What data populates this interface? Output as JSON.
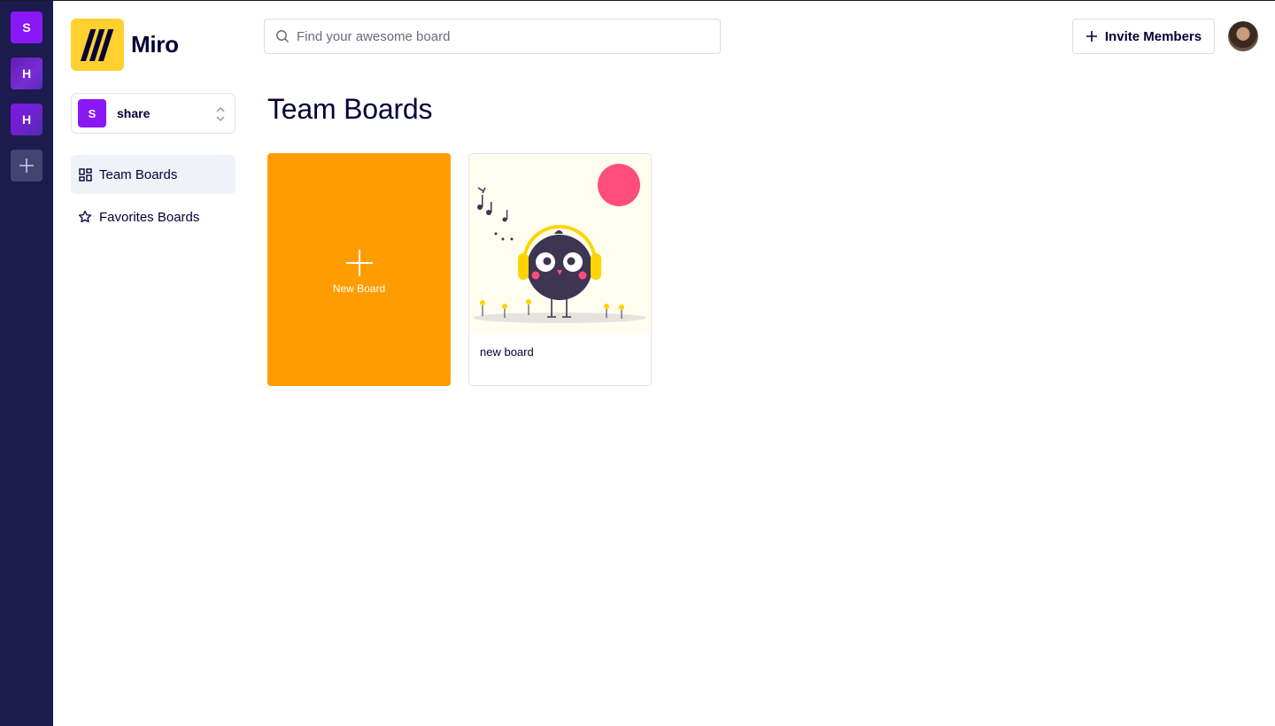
{
  "workspaces": [
    {
      "letter": "S",
      "color": "#8a17f5"
    },
    {
      "letter": "H",
      "color": "#6d22c9"
    },
    {
      "letter": "H",
      "color": "#7e18e8"
    }
  ],
  "brand": {
    "name": "Miro",
    "logo_color": "#ffd02f"
  },
  "team_selector": {
    "avatar_letter": "S",
    "name": "share"
  },
  "nav": [
    {
      "label": "Team Boards",
      "icon": "grid-icon",
      "active": true
    },
    {
      "label": "Favorites Boards",
      "icon": "star-icon",
      "active": false
    }
  ],
  "search": {
    "placeholder": "Find your awesome board",
    "value": ""
  },
  "header": {
    "invite_label": "Invite Members"
  },
  "main": {
    "title": "Team Boards",
    "new_board_label": "New Board",
    "boards": [
      {
        "title": "new board"
      }
    ]
  },
  "colors": {
    "rail": "#1c1b4d",
    "new_board": "#ff9d00",
    "accent_purple": "#8a17f5",
    "text": "#050038"
  }
}
